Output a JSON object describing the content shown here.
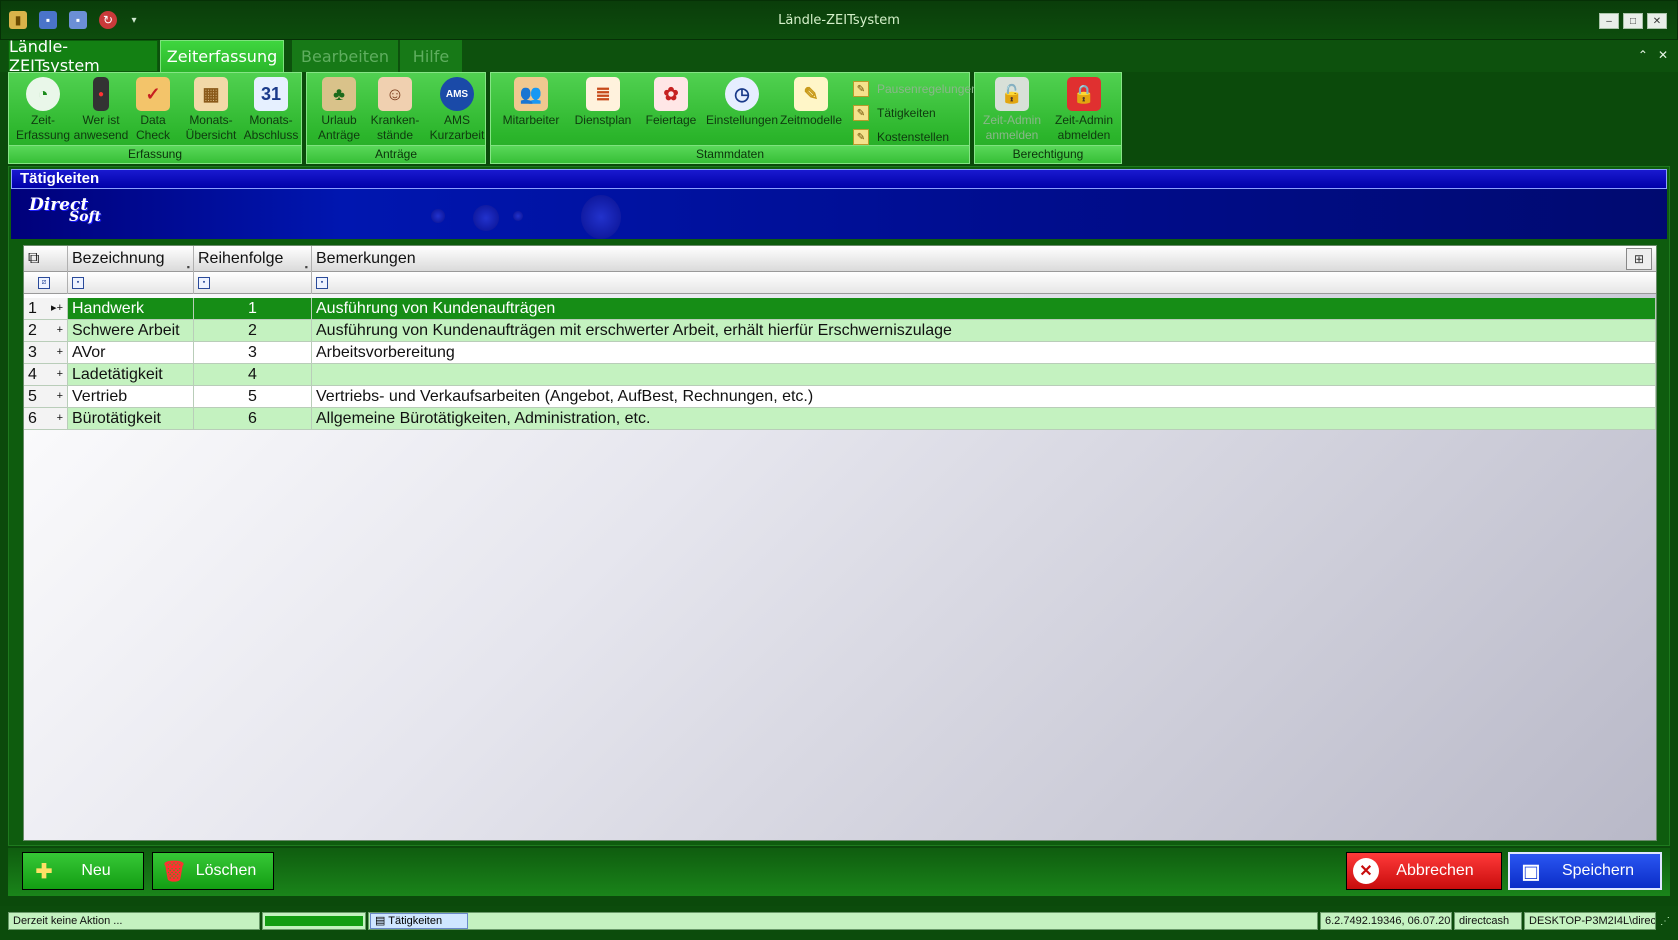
{
  "window": {
    "title": "Ländle-ZEITsystem",
    "qat_icons": [
      "app-icon",
      "save-icon",
      "save-all-icon",
      "refresh-icon",
      "customize-icon"
    ]
  },
  "tabs": [
    {
      "label": "Ländle-ZEITsystem"
    },
    {
      "label": "Zeiterfassung"
    },
    {
      "label": "Bearbeiten"
    },
    {
      "label": "Hilfe"
    }
  ],
  "ribbon": {
    "groups": [
      {
        "label": "Erfassung"
      },
      {
        "label": "Anträge"
      },
      {
        "label": "Stammdaten"
      },
      {
        "label": "Berechtigung"
      }
    ],
    "buttons": [
      {
        "line1": "Zeit-",
        "line2": "Erfassung",
        "icon": "clock-icon"
      },
      {
        "line1": "Wer ist",
        "line2": "anwesend",
        "icon": "traffic-light-icon"
      },
      {
        "line1": "Data",
        "line2": "Check",
        "icon": "clipboard-check-icon"
      },
      {
        "line1": "Monats-",
        "line2": "Übersicht",
        "icon": "month-grid-icon"
      },
      {
        "line1": "Monats-",
        "line2": "Abschluss",
        "icon": "calendar-icon"
      },
      {
        "line1": "Urlaub",
        "line2": "Anträge",
        "icon": "palm-tree-icon"
      },
      {
        "line1": "Kranken-",
        "line2": "stände",
        "icon": "doctor-icon"
      },
      {
        "line1": "AMS",
        "line2": "Kurzarbeit",
        "icon": "ams-icon"
      },
      {
        "line1": "Mitarbeiter",
        "line2": "",
        "icon": "employees-icon"
      },
      {
        "line1": "Dienstplan",
        "line2": "",
        "icon": "schedule-icon"
      },
      {
        "line1": "Feiertage",
        "line2": "",
        "icon": "holiday-calendar-icon"
      },
      {
        "line1": "Einstellungen",
        "line2": "",
        "icon": "settings-clock-icon"
      },
      {
        "line1": "Zeitmodelle",
        "line2": "",
        "icon": "pencil-note-icon"
      },
      {
        "line1": "Zeit-Admin",
        "line2": "anmelden",
        "icon": "lock-open-icon"
      },
      {
        "line1": "Zeit-Admin",
        "line2": "abmelden",
        "icon": "lock-red-icon"
      }
    ],
    "small_items": [
      {
        "label": "Pausenregelungen",
        "icon": "note-icon"
      },
      {
        "label": "Tätigkeiten",
        "icon": "note-icon"
      },
      {
        "label": "Kostenstellen",
        "icon": "note-icon"
      }
    ]
  },
  "page": {
    "title": "Tätigkeiten",
    "logo_text1": "Direct",
    "logo_text2": "Soft"
  },
  "grid": {
    "columns": [
      "Bezeichnung",
      "Reihenfolge",
      "Bemerkungen"
    ],
    "rows": [
      {
        "no": "1",
        "bezeichnung": "Handwerk",
        "reihenfolge": "1",
        "bemerkungen": "Ausführung von Kundenaufträgen"
      },
      {
        "no": "2",
        "bezeichnung": "Schwere Arbeit",
        "reihenfolge": "2",
        "bemerkungen": "Ausführung von Kundenaufträgen mit erschwerter Arbeit, erhält hierfür Erschwerniszulage"
      },
      {
        "no": "3",
        "bezeichnung": "AVor",
        "reihenfolge": "3",
        "bemerkungen": "Arbeitsvorbereitung"
      },
      {
        "no": "4",
        "bezeichnung": "Ladetätigkeit",
        "reihenfolge": "4",
        "bemerkungen": ""
      },
      {
        "no": "5",
        "bezeichnung": "Vertrieb",
        "reihenfolge": "5",
        "bemerkungen": "Vertriebs- und Verkaufsarbeiten (Angebot, AufBest, Rechnungen, etc.)"
      },
      {
        "no": "6",
        "bezeichnung": "Bürotätigkeit",
        "reihenfolge": "6",
        "bemerkungen": "Allgemeine Bürotätigkeiten, Administration, etc."
      }
    ],
    "selected_row": 1
  },
  "buttons": {
    "new": "Neu",
    "delete": "Löschen",
    "cancel": "Abbrechen",
    "save": "Speichern"
  },
  "status": {
    "action": "Derzeit keine Aktion ...",
    "doc_tab": "Tätigkeiten",
    "version": "6.2.7492.19346, 06.07.20",
    "db": "directcash",
    "machine": "DESKTOP-P3M2I4L\\direc",
    "progress": 1.0
  },
  "colors": {
    "accent_green": "#139d13",
    "selected_row": "#168d16",
    "alt_row": "#c4f2c0",
    "header_blue": "#0000a8",
    "cancel_red": "#c80c0c",
    "save_blue": "#0b2dc7"
  }
}
